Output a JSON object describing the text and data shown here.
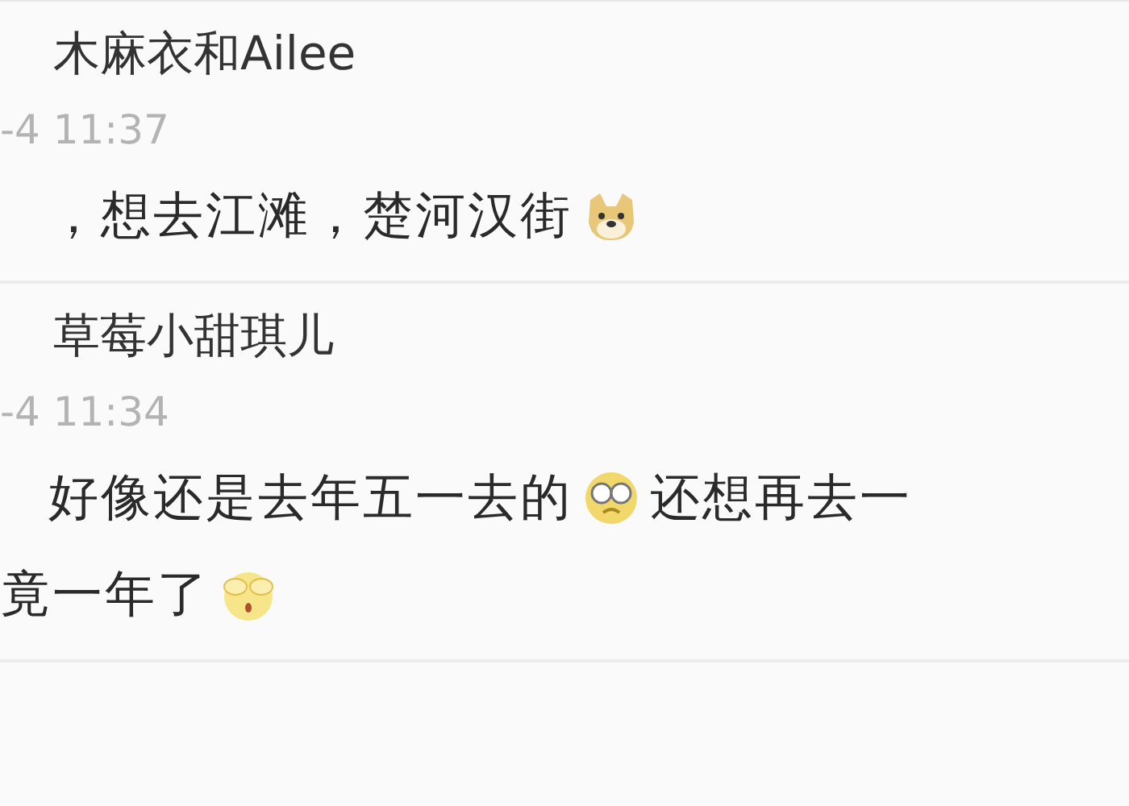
{
  "comments": [
    {
      "name": "木麻衣和Ailee",
      "time": "-4 11:37",
      "lines": [
        [
          {
            "kind": "text",
            "text": "，想去江滩，楚河汉街"
          },
          {
            "kind": "emoji"
          }
        ]
      ]
    },
    {
      "name": "草莓小甜琪儿",
      "time": "-4 11:34",
      "lines": [
        [
          {
            "kind": "text",
            "text": "好像还是去年五一去的"
          },
          {
            "kind": "emoji"
          },
          {
            "kind": "text",
            "text": "还想再去一"
          }
        ],
        [
          {
            "kind": "text",
            "text": "竟一年了"
          },
          {
            "kind": "emoji"
          }
        ]
      ]
    }
  ]
}
